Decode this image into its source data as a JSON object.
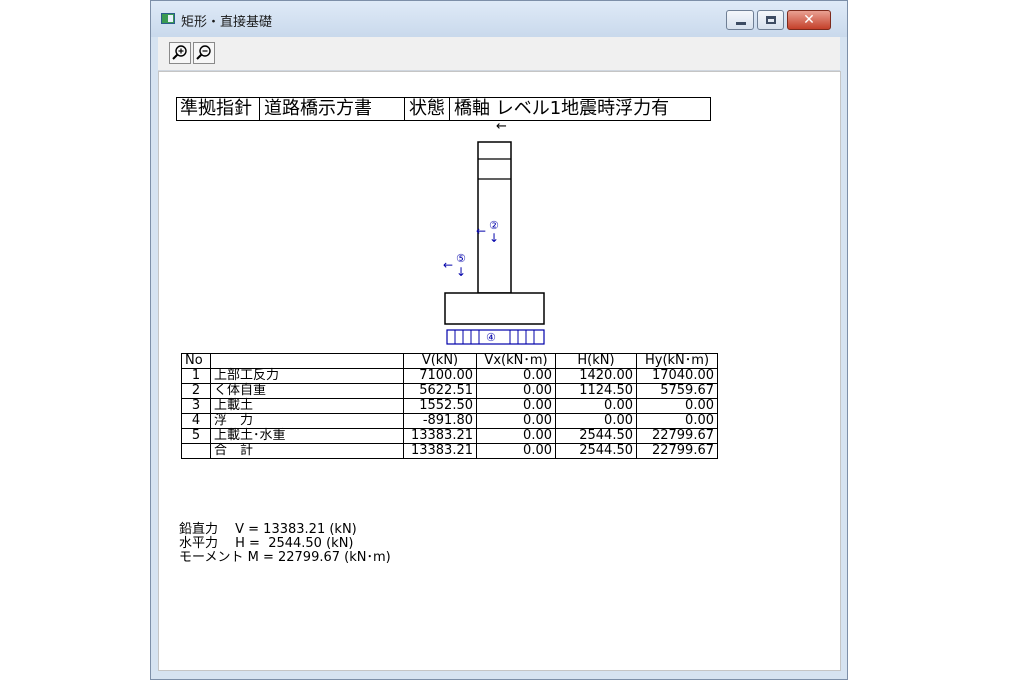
{
  "window": {
    "title": "矩形・直接基礎",
    "close_glyph": "✕"
  },
  "toolbar": {
    "zoom_in_label": "zoom-in",
    "zoom_out_label": "zoom-out"
  },
  "header": {
    "label1": "準拠指針",
    "value1": "道路橋示方書",
    "label2": "状態",
    "value2": "橋軸 レベル1地震時浮力有"
  },
  "diagram": {
    "markers": [
      {
        "symbol": "②",
        "arrow_h": "←",
        "arrow_v": "↓"
      },
      {
        "symbol": "⑤",
        "arrow_h": "←",
        "arrow_v": "↓"
      },
      {
        "symbol": "④"
      }
    ],
    "top_arrow": "←"
  },
  "table": {
    "columns": [
      "No",
      "",
      "V(kN)",
      "Vx(kN･m)",
      "H(kN)",
      "Hy(kN･m)"
    ],
    "rows": [
      {
        "no": "1",
        "name": "上部工反力",
        "v": "7100.00",
        "vx": "0.00",
        "h": "1420.00",
        "hy": "17040.00"
      },
      {
        "no": "2",
        "name": "く体自重",
        "v": "5622.51",
        "vx": "0.00",
        "h": "1124.50",
        "hy": "5759.67"
      },
      {
        "no": "3",
        "name": "上載土",
        "v": "1552.50",
        "vx": "0.00",
        "h": "0.00",
        "hy": "0.00"
      },
      {
        "no": "4",
        "name": "浮　力",
        "v": "-891.80",
        "vx": "0.00",
        "h": "0.00",
        "hy": "0.00"
      },
      {
        "no": "5",
        "name": "上載土･水重",
        "v": "13383.21",
        "vx": "0.00",
        "h": "2544.50",
        "hy": "22799.67"
      },
      {
        "no": "",
        "name": "合　計",
        "v": "13383.21",
        "vx": "0.00",
        "h": "2544.50",
        "hy": "22799.67"
      }
    ]
  },
  "summary": {
    "line1": "鉛直力　 V = 13383.21 (kN)",
    "line2": "水平力　 H =  2544.50 (kN)",
    "line3": "モーメント M = 22799.67 (kN･m)"
  }
}
